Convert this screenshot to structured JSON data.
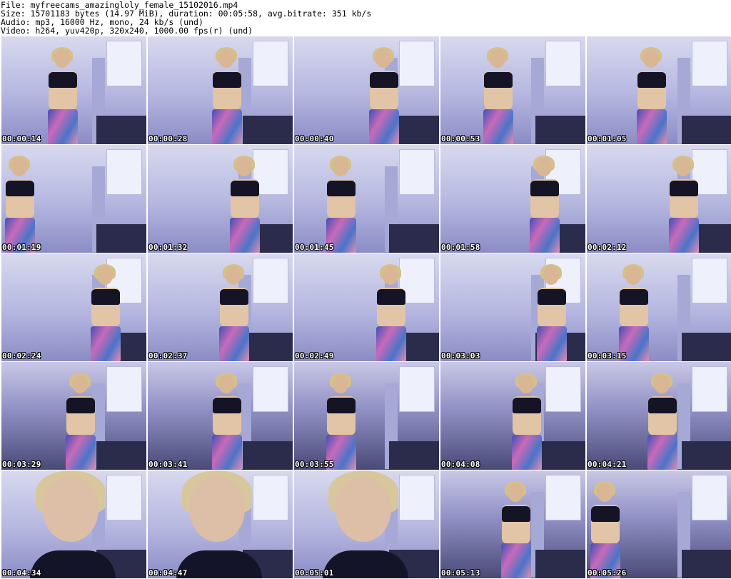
{
  "header": {
    "file_line": "File: myfreecams_amazingloly_female_15102016.mp4",
    "size_line": "Size: 15701183 bytes (14.97 MiB), duration: 00:05:58, avg.bitrate: 351 kb/s",
    "audio_line": "Audio: mp3, 16000 Hz, mono, 24 kb/s (und)",
    "video_line": "Video: h264, yuv420p, 320x240, 1000.00 fps(r) (und)"
  },
  "thumbnails": [
    {
      "timestamp": "00:00:14"
    },
    {
      "timestamp": "00:00:28"
    },
    {
      "timestamp": "00:00:40"
    },
    {
      "timestamp": "00:00:53"
    },
    {
      "timestamp": "00:01:05"
    },
    {
      "timestamp": "00:01:19"
    },
    {
      "timestamp": "00:01:32"
    },
    {
      "timestamp": "00:01:45"
    },
    {
      "timestamp": "00:01:58"
    },
    {
      "timestamp": "00:02:12"
    },
    {
      "timestamp": "00:02:24"
    },
    {
      "timestamp": "00:02:37"
    },
    {
      "timestamp": "00:02:49"
    },
    {
      "timestamp": "00:03:03"
    },
    {
      "timestamp": "00:03:15"
    },
    {
      "timestamp": "00:03:29"
    },
    {
      "timestamp": "00:03:41"
    },
    {
      "timestamp": "00:03:55"
    },
    {
      "timestamp": "00:04:08"
    },
    {
      "timestamp": "00:04:21"
    },
    {
      "timestamp": "00:04:34"
    },
    {
      "timestamp": "00:04:47"
    },
    {
      "timestamp": "00:05:01"
    },
    {
      "timestamp": "00:05:13"
    },
    {
      "timestamp": "00:05:26"
    }
  ],
  "colors": {
    "background": "#ffffff",
    "header_text": "#000000",
    "timestamp_text": "#ffffff",
    "timestamp_outline": "#000000"
  }
}
